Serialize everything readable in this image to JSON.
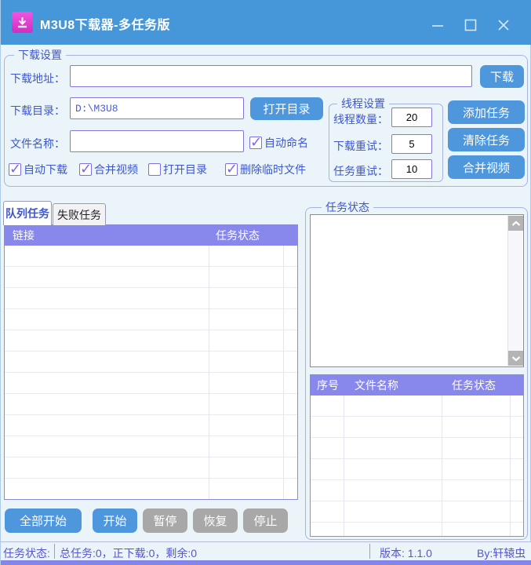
{
  "window": {
    "title": "M3U8下载器-多任务版"
  },
  "colors": {
    "titlebar": "#4597da",
    "background": "#ebf5f9",
    "accent_blue_button": "#4f97dc",
    "gray_button": "#a8a8a8",
    "table_header_purple": "#8787ec",
    "label_blue": "#3d56d4",
    "app_icon_magenta": "#e040d4"
  },
  "download_settings": {
    "group_label": "下载设置",
    "url_label": "下载地址：",
    "url_value": "",
    "download_button": "下载",
    "dir_label": "下载目录：",
    "dir_value": "D:\\M3U8",
    "open_dir_button": "打开目录",
    "filename_label": "文件名称：",
    "filename_value": "",
    "auto_name": {
      "label": "自动命名",
      "checked": true
    },
    "options": [
      {
        "label": "自动下载",
        "checked": true
      },
      {
        "label": "合并视频",
        "checked": true
      },
      {
        "label": "打开目录",
        "checked": false
      },
      {
        "label": "删除临时文件",
        "checked": true
      }
    ],
    "thread_settings": {
      "group_label": "线程设置",
      "fields": [
        {
          "label": "线程数量：",
          "value": "20"
        },
        {
          "label": "下载重试：",
          "value": "5"
        },
        {
          "label": "任务重试：",
          "value": "10"
        }
      ]
    },
    "action_buttons": [
      {
        "label": "添加任务"
      },
      {
        "label": "清除任务"
      },
      {
        "label": "合并视频"
      }
    ]
  },
  "task_panel": {
    "tabs": [
      {
        "label": "队列任务",
        "active": true
      },
      {
        "label": "失败任务",
        "active": false
      }
    ],
    "queue_table": {
      "headers": [
        "链接",
        "任务状态"
      ],
      "rows": []
    },
    "control_buttons": [
      {
        "label": "全部开始",
        "style": "blue"
      },
      {
        "label": "开始",
        "style": "blue"
      },
      {
        "label": "暂停",
        "style": "gray"
      },
      {
        "label": "恢复",
        "style": "gray"
      },
      {
        "label": "停止",
        "style": "gray"
      }
    ]
  },
  "status_panel": {
    "group_label": "任务状态",
    "log_content": "",
    "table": {
      "headers": [
        "序号",
        "文件名称",
        "任务状态"
      ],
      "rows": []
    }
  },
  "status_bar": {
    "label": "任务状态:",
    "summary": "总任务:0，正下载:0，剩余:0",
    "version": "版本: 1.1.0",
    "author": "By:轩辕虫"
  }
}
